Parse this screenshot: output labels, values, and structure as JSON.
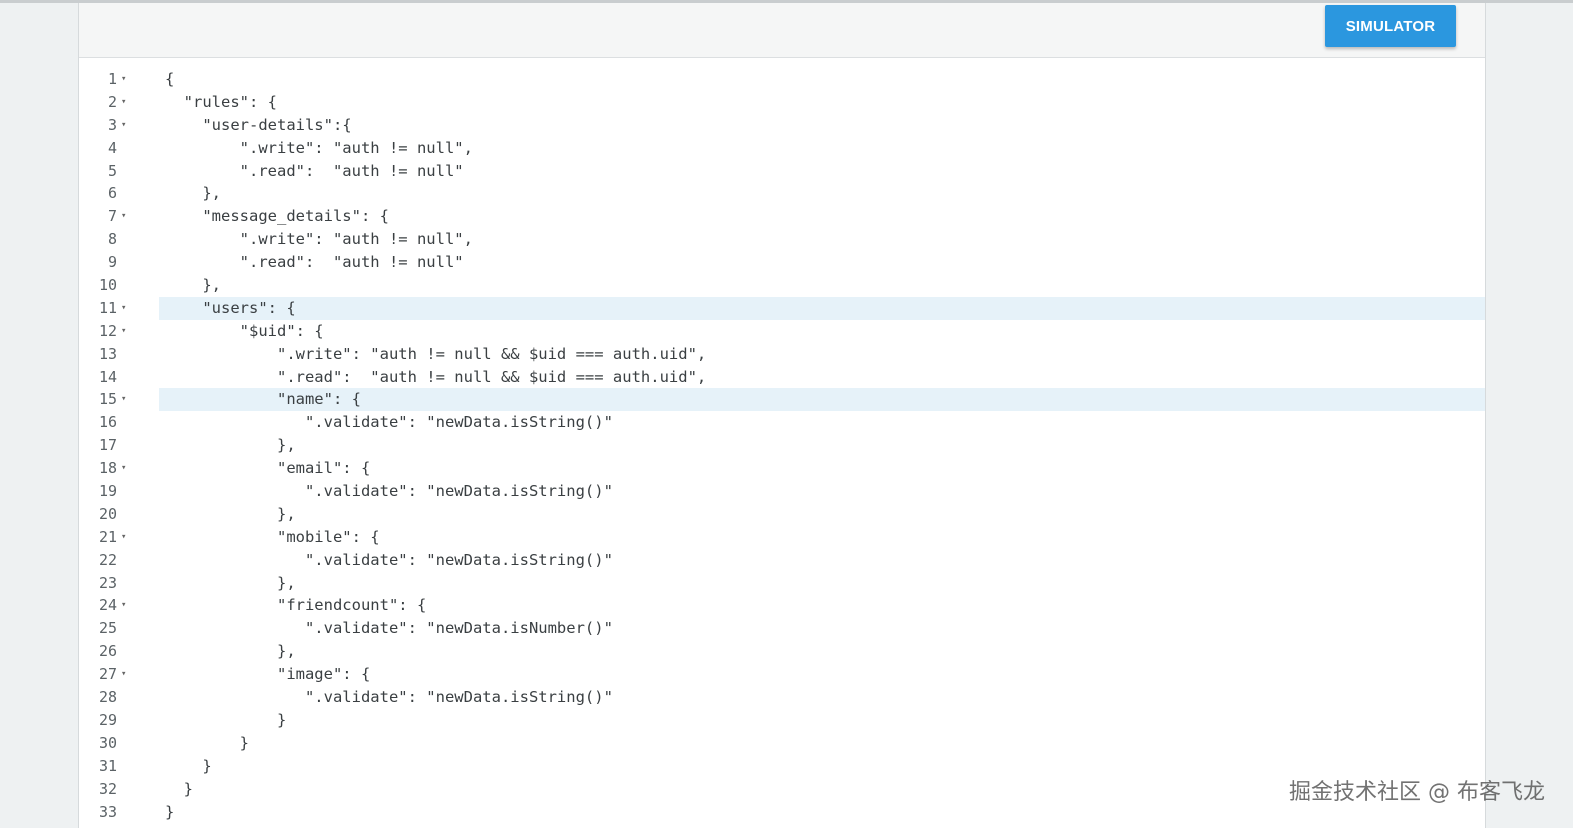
{
  "toolbar": {
    "simulator_label": "SIMULATOR"
  },
  "editor": {
    "lines": [
      {
        "n": "1",
        "fold": true,
        "text": "{"
      },
      {
        "n": "2",
        "fold": true,
        "text": "  \"rules\": {"
      },
      {
        "n": "3",
        "fold": true,
        "text": "    \"user-details\":{"
      },
      {
        "n": "4",
        "fold": false,
        "text": "        \".write\": \"auth != null\","
      },
      {
        "n": "5",
        "fold": false,
        "text": "        \".read\":  \"auth != null\""
      },
      {
        "n": "6",
        "fold": false,
        "text": "    },"
      },
      {
        "n": "7",
        "fold": true,
        "text": "    \"message_details\": {"
      },
      {
        "n": "8",
        "fold": false,
        "text": "        \".write\": \"auth != null\","
      },
      {
        "n": "9",
        "fold": false,
        "text": "        \".read\":  \"auth != null\""
      },
      {
        "n": "10",
        "fold": false,
        "text": "    },"
      },
      {
        "n": "11",
        "fold": true,
        "text": "    \"users\": {",
        "highlight": true
      },
      {
        "n": "12",
        "fold": true,
        "text": "        \"$uid\": {"
      },
      {
        "n": "13",
        "fold": false,
        "text": "            \".write\": \"auth != null && $uid === auth.uid\","
      },
      {
        "n": "14",
        "fold": false,
        "text": "            \".read\":  \"auth != null && $uid === auth.uid\","
      },
      {
        "n": "15",
        "fold": true,
        "text": "            \"name\": {",
        "highlight": true
      },
      {
        "n": "16",
        "fold": false,
        "text": "               \".validate\": \"newData.isString()\""
      },
      {
        "n": "17",
        "fold": false,
        "text": "            },"
      },
      {
        "n": "18",
        "fold": true,
        "text": "            \"email\": {"
      },
      {
        "n": "19",
        "fold": false,
        "text": "               \".validate\": \"newData.isString()\""
      },
      {
        "n": "20",
        "fold": false,
        "text": "            },"
      },
      {
        "n": "21",
        "fold": true,
        "text": "            \"mobile\": {"
      },
      {
        "n": "22",
        "fold": false,
        "text": "               \".validate\": \"newData.isString()\""
      },
      {
        "n": "23",
        "fold": false,
        "text": "            },"
      },
      {
        "n": "24",
        "fold": true,
        "text": "            \"friendcount\": {"
      },
      {
        "n": "25",
        "fold": false,
        "text": "               \".validate\": \"newData.isNumber()\""
      },
      {
        "n": "26",
        "fold": false,
        "text": "            },"
      },
      {
        "n": "27",
        "fold": true,
        "text": "            \"image\": {"
      },
      {
        "n": "28",
        "fold": false,
        "text": "               \".validate\": \"newData.isString()\""
      },
      {
        "n": "29",
        "fold": false,
        "text": "            }"
      },
      {
        "n": "30",
        "fold": false,
        "text": "        }"
      },
      {
        "n": "31",
        "fold": false,
        "text": "    }"
      },
      {
        "n": "32",
        "fold": false,
        "text": "  }"
      },
      {
        "n": "33",
        "fold": false,
        "text": "}"
      }
    ]
  },
  "watermark": "掘金技术社区 @ 布客飞龙",
  "colors": {
    "button": "#2b97df",
    "highlight": "#e6f2f9"
  }
}
